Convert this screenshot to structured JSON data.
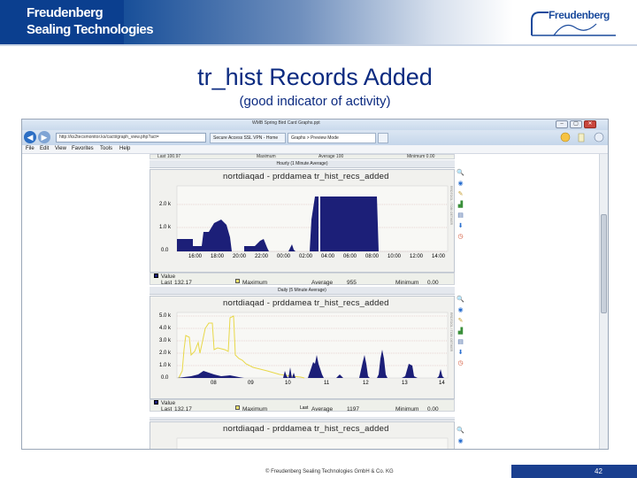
{
  "header": {
    "brand_line1": "Freudenberg",
    "brand_line2": "Sealing Technologies",
    "logo_text": "Freudenberg",
    "colors": {
      "brand_blue": "#0b3f8f",
      "title_blue": "#0b2a80"
    }
  },
  "slide": {
    "title": "tr_hist Records Added",
    "subtitle": "(good indicator of activity)"
  },
  "browser": {
    "window_title": "WMB Spring Bird Card Graphs.ppt",
    "address": "http://ks2tecsmonitor.ks/cacti/graph_view.php?act=",
    "tabs": [
      "Secure Access SSL VPN - Home",
      "Graphs > Preview Mode",
      ""
    ],
    "menu": [
      "File",
      "Edit",
      "View",
      "Favorites",
      "Tools",
      "Help"
    ],
    "window_buttons": [
      "–",
      "▢",
      "✕"
    ],
    "top_strip": {
      "left": "Last 100.97",
      "mid": "Maximum",
      "avg": "Average 100",
      "min": "Minimum 0.00"
    }
  },
  "graphs": [
    {
      "caption": "Hourly (1 Minute Average)",
      "title": "nortdiaqad - prddamea tr_hist_recs_added",
      "y_ticks": [
        "2.0 k",
        "1.0 k",
        "0.0"
      ],
      "x_ticks": [
        "16:00",
        "18:00",
        "20:00",
        "22:00",
        "00:00",
        "02:00",
        "04:00",
        "06:00",
        "08:00",
        "10:00",
        "12:00",
        "14:00"
      ],
      "legend": {
        "value_label": "Value",
        "last": "Last",
        "last_val": "132.17",
        "maximum": "Maximum",
        "average": "Average",
        "average_val": "955",
        "minimum": "Minimum",
        "minimum_val": "0.00"
      },
      "side_label": "RRDTOOL / TOBI OETIKER"
    },
    {
      "caption": "Daily (5 Minute Average)",
      "title": "nortdiaqad - prddamea tr_hist_recs_added",
      "y_ticks": [
        "5.0 k",
        "4.0 k",
        "3.0 k",
        "2.0 k",
        "1.0 k",
        "0.0"
      ],
      "x_ticks": [
        "08",
        "09",
        "10",
        "11",
        "12",
        "13",
        "14"
      ],
      "legend": {
        "value_label": "Value",
        "last": "Last",
        "last_val": "132.17",
        "maximum": "Maximum",
        "average": "Average",
        "average_val": "1197",
        "minimum": "Minimum",
        "minimum_val": "0.00"
      },
      "x_caption": "Last",
      "side_label": "RRDTOOL / TOBI OETIKER"
    },
    {
      "caption": "",
      "title": "nortdiaqad - prddamea tr_hist_recs_added"
    }
  ],
  "footer": {
    "copyright": "© Freudenberg Sealing Technologies GmbH & Co. KG",
    "page": "42"
  }
}
